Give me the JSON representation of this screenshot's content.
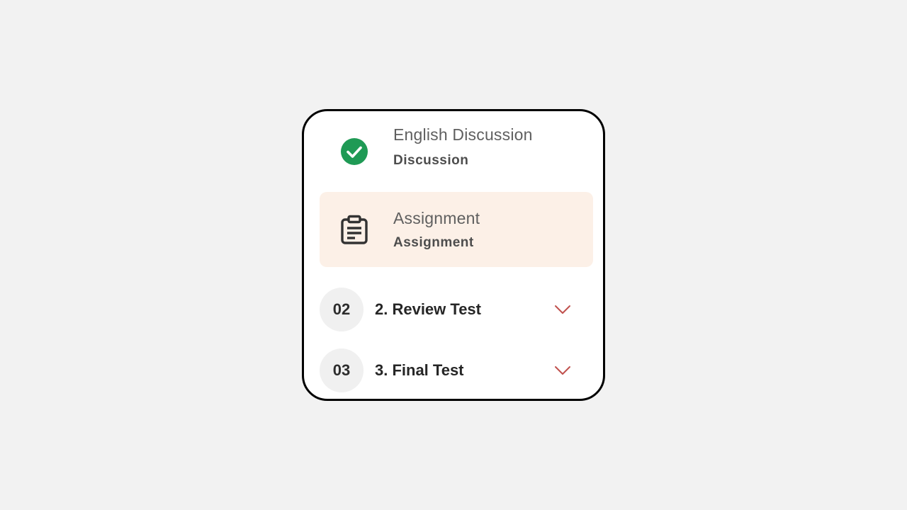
{
  "lessons": [
    {
      "title": "English Discussion",
      "type": "Discussion",
      "status": "completed",
      "icon": "check-circle-icon"
    },
    {
      "title": "Assignment",
      "type": "Assignment",
      "status": "active",
      "icon": "clipboard-icon"
    }
  ],
  "sections": [
    {
      "number": "02",
      "title": "2. Review Test",
      "icon": "chevron-down-icon"
    },
    {
      "number": "03",
      "title": "3. Final Test",
      "icon": "chevron-down-icon"
    }
  ],
  "colors": {
    "completed": "#1f9a55",
    "active_bg": "#fcf0e7",
    "chevron": "#c0504d",
    "border": "#000000"
  }
}
